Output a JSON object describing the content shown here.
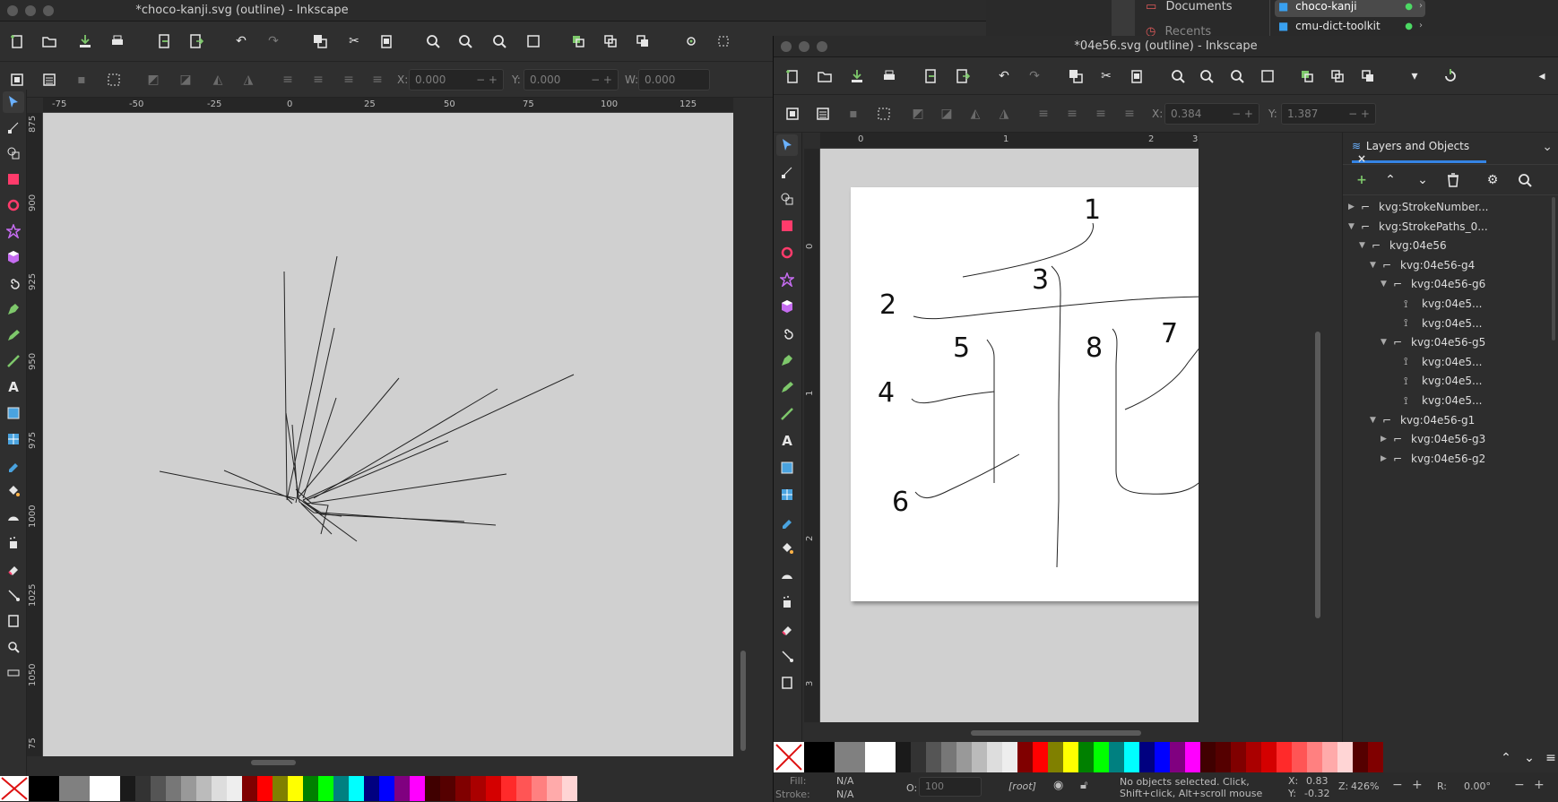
{
  "left_window": {
    "title": "*choco-kanji.svg (outline) - Inkscape",
    "toolbar2": {
      "x_label": "X:",
      "x_value": "0.000",
      "y_label": "Y:",
      "y_value": "0.000",
      "w_label": "W:",
      "w_value": "0.000"
    },
    "ruler_h": [
      "-75",
      "-50",
      "-25",
      "0",
      "25",
      "50",
      "75",
      "100",
      "125"
    ],
    "ruler_v": [
      "875",
      "900",
      "925",
      "950",
      "975",
      "1000",
      "1025",
      "1050",
      "75"
    ]
  },
  "finder": {
    "documents": "Documents",
    "recents": "Recents",
    "items": [
      {
        "name": "choco-kanji",
        "selected": true
      },
      {
        "name": "cmu-dict-toolkit",
        "selected": false
      }
    ]
  },
  "right_window": {
    "title": "*04e56.svg (outline) - Inkscape",
    "toolbar2": {
      "x_label": "X:",
      "x_value": "0.384",
      "y_label": "Y:",
      "y_value": "1.387"
    },
    "ruler_h": [
      "0",
      "1",
      "2",
      "3"
    ],
    "ruler_v": [
      "0",
      "1",
      "2",
      "3"
    ],
    "stroke_numbers": [
      "1",
      "2",
      "3",
      "4",
      "5",
      "6",
      "7",
      "8"
    ],
    "status": {
      "fill_label": "Fill:",
      "fill_value": "N/A",
      "stroke_label": "Stroke:",
      "stroke_value": "N/A",
      "opacity_label": "O:",
      "opacity_value": "100",
      "layer": "[root]",
      "message": "No objects selected. Click, Shift+click, Alt+scroll mouse o...",
      "cx_label": "X:",
      "cx_value": "0.83",
      "cy_label": "Y:",
      "cy_value": "-0.32",
      "zoom_label": "Z:",
      "zoom_value": "426%",
      "rot_label": "R:",
      "rot_value": "0.00°"
    }
  },
  "layers_panel": {
    "tab_label": "Layers and Objects",
    "rows": [
      {
        "label": "kvg:StrokeNumber...",
        "indent": 0,
        "arrow": "right",
        "kind": "group"
      },
      {
        "label": "kvg:StrokePaths_0...",
        "indent": 0,
        "arrow": "down",
        "kind": "group"
      },
      {
        "label": "kvg:04e56",
        "indent": 1,
        "arrow": "down",
        "kind": "group"
      },
      {
        "label": "kvg:04e56-g4",
        "indent": 2,
        "arrow": "down",
        "kind": "group"
      },
      {
        "label": "kvg:04e56-g6",
        "indent": 3,
        "arrow": "down",
        "kind": "group"
      },
      {
        "label": "kvg:04e5...",
        "indent": 4,
        "arrow": "",
        "kind": "path"
      },
      {
        "label": "kvg:04e5...",
        "indent": 4,
        "arrow": "",
        "kind": "path"
      },
      {
        "label": "kvg:04e56-g5",
        "indent": 3,
        "arrow": "down",
        "kind": "group"
      },
      {
        "label": "kvg:04e5...",
        "indent": 4,
        "arrow": "",
        "kind": "path"
      },
      {
        "label": "kvg:04e5...",
        "indent": 4,
        "arrow": "",
        "kind": "path"
      },
      {
        "label": "kvg:04e5...",
        "indent": 4,
        "arrow": "",
        "kind": "path"
      },
      {
        "label": "kvg:04e56-g1",
        "indent": 2,
        "arrow": "down",
        "kind": "group"
      },
      {
        "label": "kvg:04e56-g3",
        "indent": 3,
        "arrow": "right",
        "kind": "group"
      },
      {
        "label": "kvg:04e56-g2",
        "indent": 3,
        "arrow": "right",
        "kind": "group"
      }
    ]
  },
  "colors": {
    "canvas_bg": "#d0d0d0",
    "page_bg": "#ffffff",
    "accent": "#3584e4",
    "window_bg": "#2d2d2d"
  }
}
